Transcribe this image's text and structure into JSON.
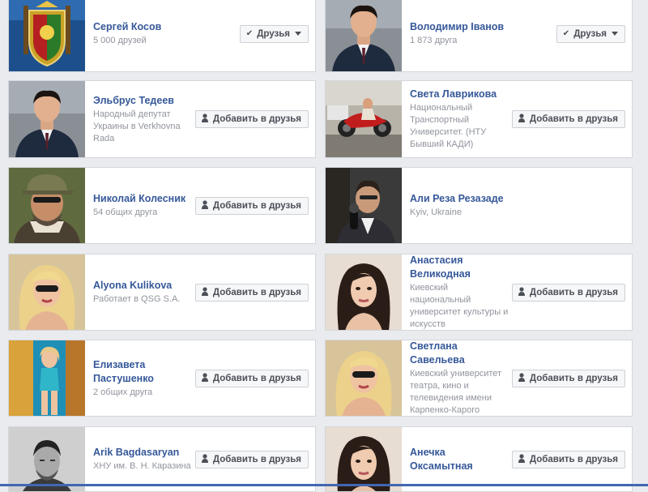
{
  "ui": {
    "accent": "#365899",
    "add_icon": "add-friend-icon",
    "friends_icon": "checkmark-icon"
  },
  "friends": [
    {
      "name": "Сергей Косов",
      "lines": [
        "5 000 друзей"
      ],
      "button": "Друзья",
      "state": "friends",
      "avatar": "coat-of-arms"
    },
    {
      "name": "Володимир Іванов",
      "lines": [
        "1 873 друга"
      ],
      "button": "Друзья",
      "state": "friends",
      "avatar": "man-suit"
    },
    {
      "name": "Эльбрус Тедеев",
      "lines": [
        "Народный депутат Украины в Verkhovna Rada"
      ],
      "button": "Добавить в друзья",
      "state": "add",
      "avatar": "man-suit"
    },
    {
      "name": "Света Лаврикова",
      "lines": [
        "Национальный Транспортный Университет. (НТУ Бывший КАДИ)"
      ],
      "button": "Добавить в друзья",
      "state": "add",
      "avatar": "motorcycle"
    },
    {
      "name": "Николай Колесник",
      "lines": [
        "54 общих друга"
      ],
      "button": "Добавить в друзья",
      "state": "add",
      "avatar": "man-cap"
    },
    {
      "name": "Али Реза Резазаде",
      "lines": [
        "Kyiv, Ukraine"
      ],
      "button": "",
      "state": "none",
      "avatar": "man-interview"
    },
    {
      "name": "Alyona Kulikova",
      "lines": [
        "Работает в QSG S.A."
      ],
      "button": "Добавить в друзья",
      "state": "add",
      "avatar": "woman-blonde"
    },
    {
      "name": "Анастасия Великодная",
      "lines": [
        "Киевский национальный университет культуры и искусств"
      ],
      "button": "Добавить в друзья",
      "state": "add",
      "avatar": "woman-dark"
    },
    {
      "name": "Елизавета Пастушенко",
      "lines": [
        "2 общих друга"
      ],
      "button": "Добавить в друзья",
      "state": "add",
      "avatar": "woman-pool"
    },
    {
      "name": "Светлана Савельева",
      "lines": [
        "Киевский университет театра, кино и телевидения имени Карпенко-Карого"
      ],
      "button": "Добавить в друзья",
      "state": "add",
      "avatar": "woman-blonde"
    },
    {
      "name": "Arik Bagdasaryan",
      "lines": [
        "ХНУ им. В. Н. Каразина"
      ],
      "button": "Добавить в друзья",
      "state": "add",
      "avatar": "man-bw"
    },
    {
      "name": "Анечка Оксамытная",
      "lines": [],
      "button": "Добавить в друзья",
      "state": "add",
      "avatar": "woman-dark"
    }
  ]
}
